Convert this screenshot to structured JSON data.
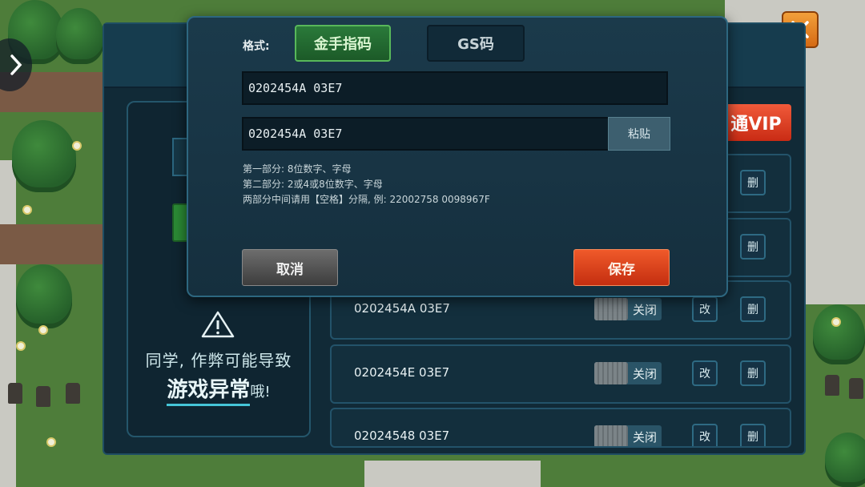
{
  "dialog": {
    "format_label": "格式:",
    "tabs": [
      {
        "label": "金手指码",
        "active": true
      },
      {
        "label": "GS码",
        "active": false
      }
    ],
    "field_1_value": "0202454A 03E7",
    "field_2_value": "0202454A 03E7",
    "paste_label": "粘贴",
    "hints": [
      "第一部分: 8位数字、字母",
      "第二部分: 2或4或8位数字、字母",
      "两部分中间请用【空格】分隔, 例: 22002758 0098967F"
    ],
    "cancel_label": "取消",
    "save_label": "保存"
  },
  "background_panel": {
    "vip_label": "通VIP",
    "warning_line_1": "同学, 作弊可能导致",
    "warning_big": "游戏异常",
    "warning_tail": "哦!"
  },
  "code_rows": [
    {
      "code": "",
      "toggle": "",
      "edit": "",
      "delete": "删"
    },
    {
      "code": "",
      "toggle": "",
      "edit": "",
      "delete": "删"
    },
    {
      "code": "0202454A 03E7",
      "toggle": "关闭",
      "edit": "改",
      "delete": "删"
    },
    {
      "code": "0202454E 03E7",
      "toggle": "关闭",
      "edit": "改",
      "delete": "删"
    },
    {
      "code": "02024548 03E7",
      "toggle": "关闭",
      "edit": "改",
      "delete": "删"
    }
  ],
  "colors": {
    "active_tab": "#2a7a3a",
    "save_button": "#e0461e",
    "vip_button": "#e0401f",
    "close_button": "#e8882a"
  },
  "icons": [
    "chevron-right-icon",
    "close-icon",
    "warning-icon"
  ]
}
